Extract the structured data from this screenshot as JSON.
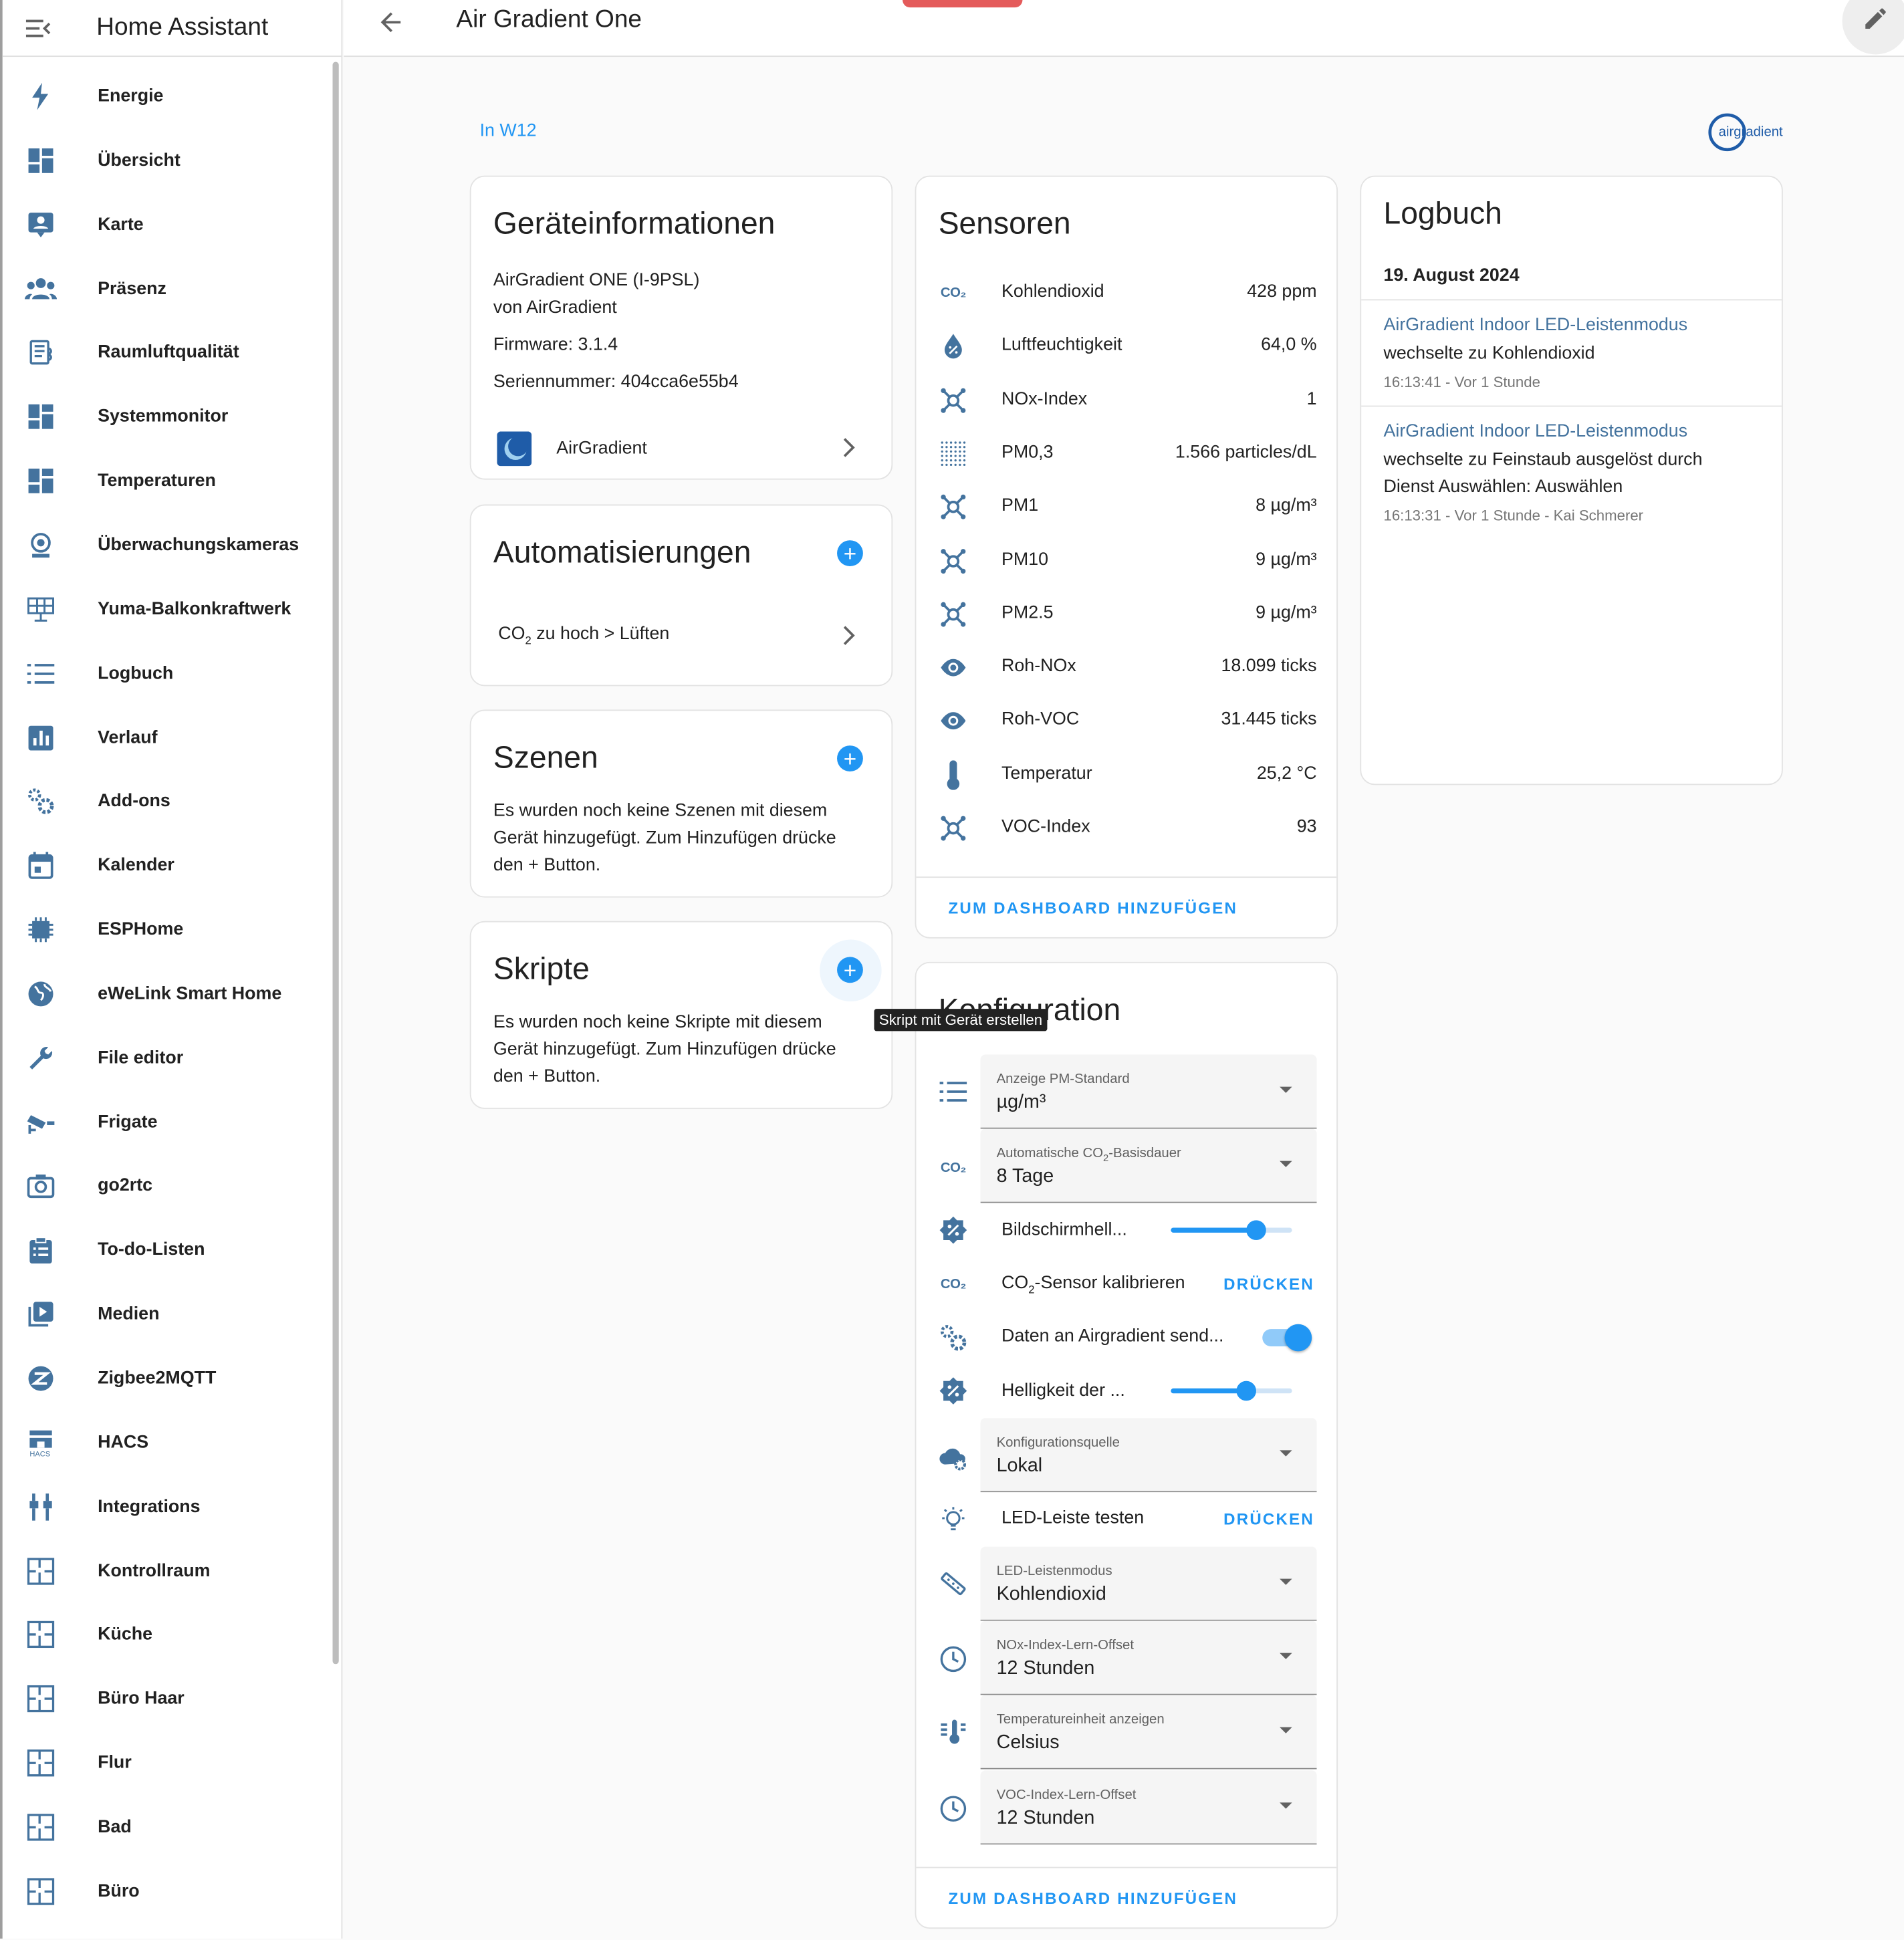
{
  "app": {
    "title": "Home Assistant",
    "page_title": "Air Gradient One",
    "breadcrumb": "In W12",
    "brand_logo_text": "airgradient"
  },
  "sidebar": {
    "items": [
      {
        "label": "Energie",
        "icon": "lightning-icon"
      },
      {
        "label": "Übersicht",
        "icon": "dashboard-icon"
      },
      {
        "label": "Karte",
        "icon": "map-account-icon"
      },
      {
        "label": "Präsenz",
        "icon": "people-icon"
      },
      {
        "label": "Raumluftqualität",
        "icon": "air-quality-icon"
      },
      {
        "label": "Systemmonitor",
        "icon": "dashboard-icon"
      },
      {
        "label": "Temperaturen",
        "icon": "dashboard-icon"
      },
      {
        "label": "Überwachungskameras",
        "icon": "webcam-icon"
      },
      {
        "label": "Yuma-Balkonkraftwerk",
        "icon": "solar-panel-icon"
      },
      {
        "label": "Logbuch",
        "icon": "list-icon"
      },
      {
        "label": "Verlauf",
        "icon": "chart-box-icon"
      },
      {
        "label": "Add-ons",
        "icon": "cogs-icon"
      },
      {
        "label": "Kalender",
        "icon": "calendar-icon"
      },
      {
        "label": "ESPHome",
        "icon": "chip-icon"
      },
      {
        "label": "eWeLink Smart Home",
        "icon": "globe-icon"
      },
      {
        "label": "File editor",
        "icon": "wrench-icon"
      },
      {
        "label": "Frigate",
        "icon": "cctv-icon"
      },
      {
        "label": "go2rtc",
        "icon": "camera-icon"
      },
      {
        "label": "To-do-Listen",
        "icon": "clipboard-list-icon"
      },
      {
        "label": "Medien",
        "icon": "play-box-icon"
      },
      {
        "label": "Zigbee2MQTT",
        "icon": "zigbee-icon"
      },
      {
        "label": "HACS",
        "icon": "hacs-icon"
      },
      {
        "label": "Integrations",
        "icon": "plug-icon"
      },
      {
        "label": "Kontrollraum",
        "icon": "floorplan-icon"
      },
      {
        "label": "Küche",
        "icon": "floorplan-icon"
      },
      {
        "label": "Büro Haar",
        "icon": "floorplan-icon"
      },
      {
        "label": "Flur",
        "icon": "floorplan-icon"
      },
      {
        "label": "Bad",
        "icon": "floorplan-icon"
      },
      {
        "label": "Büro",
        "icon": "floorplan-icon"
      }
    ]
  },
  "device_info": {
    "title": "Geräteinformationen",
    "model": "AirGradient ONE (I-9PSL)",
    "manufacturer": "von AirGradient",
    "firmware": "Firmware: 3.1.4",
    "serial": "Seriennummer: 404cca6e55b4",
    "integration": "AirGradient"
  },
  "automations": {
    "title": "Automatisierungen",
    "item_prefix": "CO",
    "item_sub": "2",
    "item_suffix": " zu hoch > Lüften"
  },
  "scenes": {
    "title": "Szenen",
    "empty_text": "Es wurden noch keine Szenen mit diesem Gerät hinzugefügt. Zum Hinzufügen drücke den + Button."
  },
  "scripts": {
    "title": "Skripte",
    "empty_text": "Es wurden noch keine Skripte mit diesem Gerät hinzugefügt. Zum Hinzufügen drücke den + Button.",
    "tooltip": "Skript mit Gerät erstellen"
  },
  "sensors": {
    "title": "Sensoren",
    "co2_icon_text": "CO₂",
    "rows": [
      {
        "name": "Kohlendioxid",
        "value": "428 ppm",
        "icon": "co2-icon"
      },
      {
        "name": "Luftfeuchtigkeit",
        "value": "64,0 %",
        "icon": "water-percent-icon"
      },
      {
        "name": "NOx-Index",
        "value": "1",
        "icon": "molecule-icon"
      },
      {
        "name": "PM0,3",
        "value": "1.566 particles/dL",
        "icon": "dots-grid-icon"
      },
      {
        "name": "PM1",
        "value": "8 µg/m³",
        "icon": "molecule-icon"
      },
      {
        "name": "PM10",
        "value": "9 µg/m³",
        "icon": "molecule-icon"
      },
      {
        "name": "PM2.5",
        "value": "9 µg/m³",
        "icon": "molecule-icon"
      },
      {
        "name": "Roh-NOx",
        "value": "18.099 ticks",
        "icon": "eye-icon"
      },
      {
        "name": "Roh-VOC",
        "value": "31.445 ticks",
        "icon": "eye-icon"
      },
      {
        "name": "Temperatur",
        "value": "25,2 °C",
        "icon": "thermometer-icon"
      },
      {
        "name": "VOC-Index",
        "value": "93",
        "icon": "molecule-icon"
      }
    ],
    "action": "ZUM DASHBOARD HINZUFÜGEN"
  },
  "config": {
    "title": "Konfiguration",
    "pm_standard": {
      "label": "Anzeige PM-Standard",
      "value": "µg/m³"
    },
    "co2_baseline": {
      "label_prefix": "Automatische CO",
      "label_sub": "2",
      "label_suffix": "-Basisdauer",
      "value": "8 Tage"
    },
    "display_brightness": {
      "label": "Bildschirmhell...",
      "level": 0.7
    },
    "co2_calibrate": {
      "label_prefix": "CO",
      "label_sub": "2",
      "label_suffix": "-Sensor kalibrieren",
      "action": "DRÜCKEN"
    },
    "send_data": {
      "label": "Daten an Airgradient send...",
      "on": true
    },
    "led_brightness": {
      "label": "Helligkeit der ...",
      "level": 0.62
    },
    "config_source": {
      "label": "Konfigurationsquelle",
      "value": "Lokal"
    },
    "led_test": {
      "label": "LED-Leiste testen",
      "action": "DRÜCKEN"
    },
    "led_mode": {
      "label": "LED-Leistenmodus",
      "value": "Kohlendioxid"
    },
    "nox_offset": {
      "label": "NOx-Index-Lern-Offset",
      "value": "12 Stunden"
    },
    "temp_unit": {
      "label": "Temperatureinheit anzeigen",
      "value": "Celsius"
    },
    "voc_offset": {
      "label": "VOC-Index-Lern-Offset",
      "value": "12 Stunden"
    },
    "action": "ZUM DASHBOARD HINZUFÜGEN"
  },
  "logbook": {
    "title": "Logbuch",
    "date": "19. August 2024",
    "entries": [
      {
        "title": "AirGradient Indoor LED-Leistenmodus",
        "text": "wechselte zu Kohlendioxid",
        "time": "16:13:41 - Vor 1 Stunde"
      },
      {
        "title": "AirGradient Indoor LED-Leistenmodus",
        "text": "wechselte zu Feinstaub ausgelöst durch Dienst Auswählen: Auswählen",
        "time": "16:13:31 - Vor 1 Stunde - Kai Schmerer"
      }
    ]
  },
  "colors": {
    "accent": "#2196f3",
    "icon": "#44739e",
    "text": "#212121",
    "muted": "#757575"
  }
}
